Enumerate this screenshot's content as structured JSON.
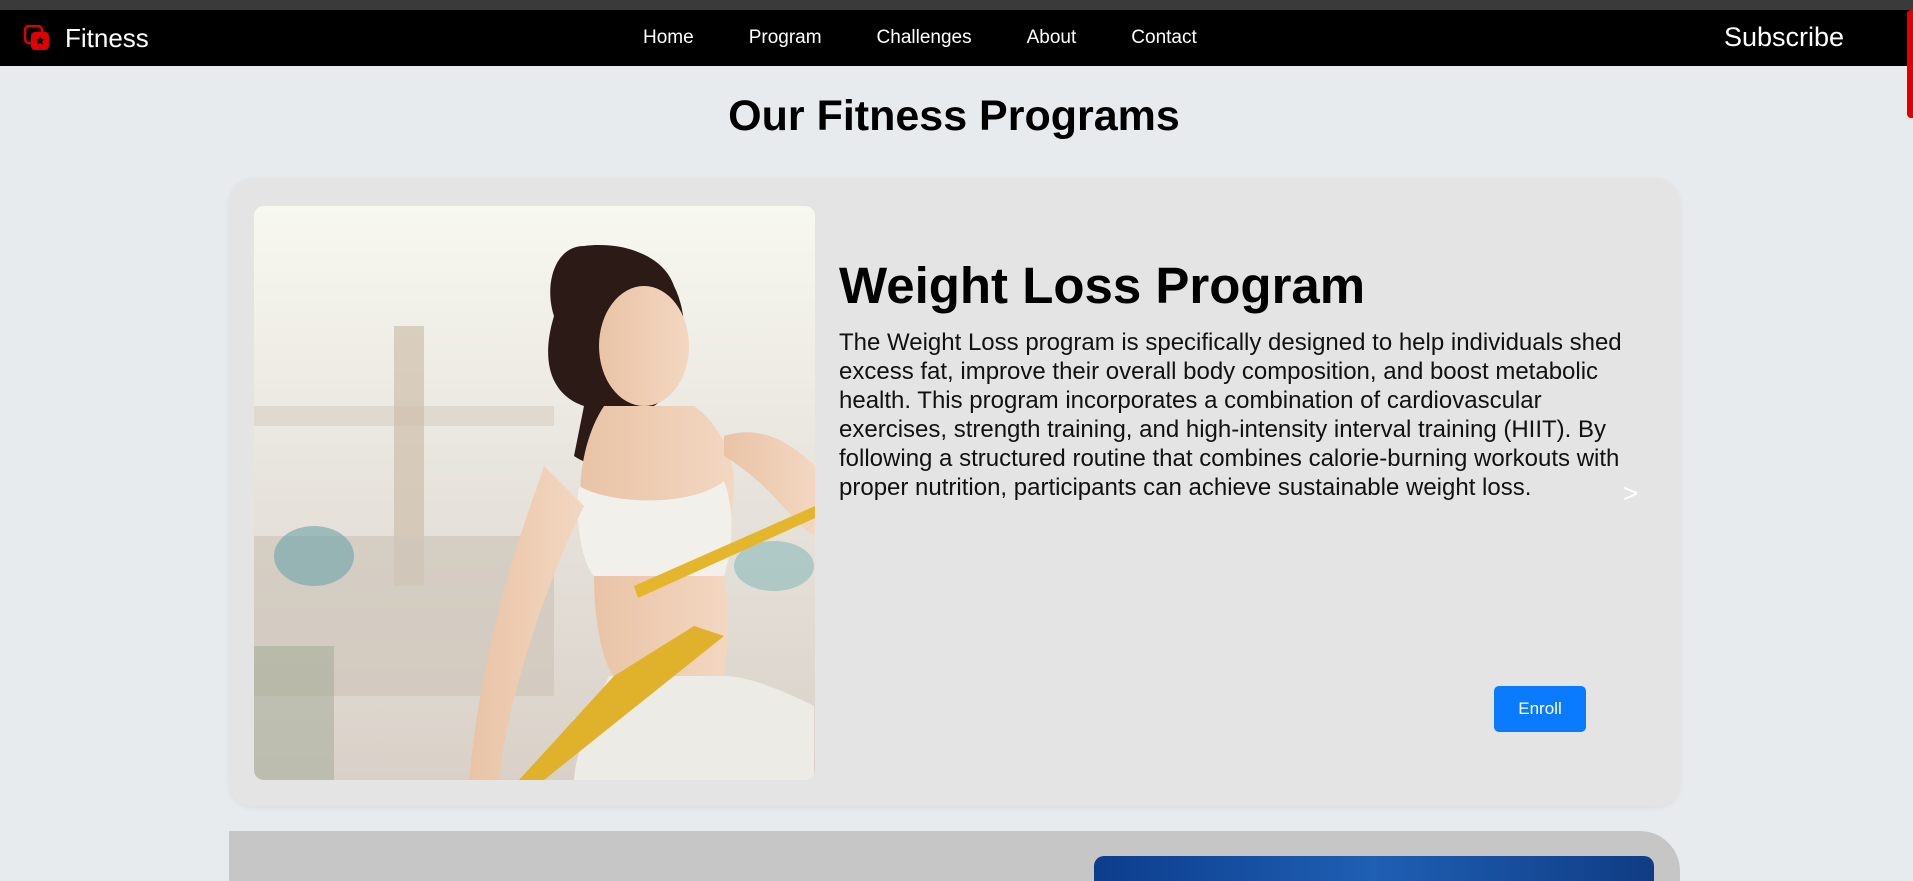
{
  "navbar": {
    "brand": "Fitness",
    "links": [
      "Home",
      "Program",
      "Challenges",
      "About",
      "Contact"
    ],
    "subscribe": "Subscribe"
  },
  "page_title": "Our Fitness Programs",
  "program": {
    "title": "Weight Loss Program",
    "description": "The Weight Loss program is specifically designed to help individuals shed excess fat, improve their overall body composition, and boost metabolic health. This program incorporates a combination of cardiovascular exercises, strength training, and high-intensity interval training (HIIT). By following a structured routine that combines calorie-burning workouts with proper nutrition, participants can achieve sustainable weight loss.",
    "enroll_label": "Enroll",
    "next_label": ">"
  },
  "colors": {
    "navbar_bg": "#000000",
    "accent": "#0a7bff",
    "brand_icon": "#e00000"
  },
  "icons": {
    "brand": "fitness-logo-icon"
  }
}
